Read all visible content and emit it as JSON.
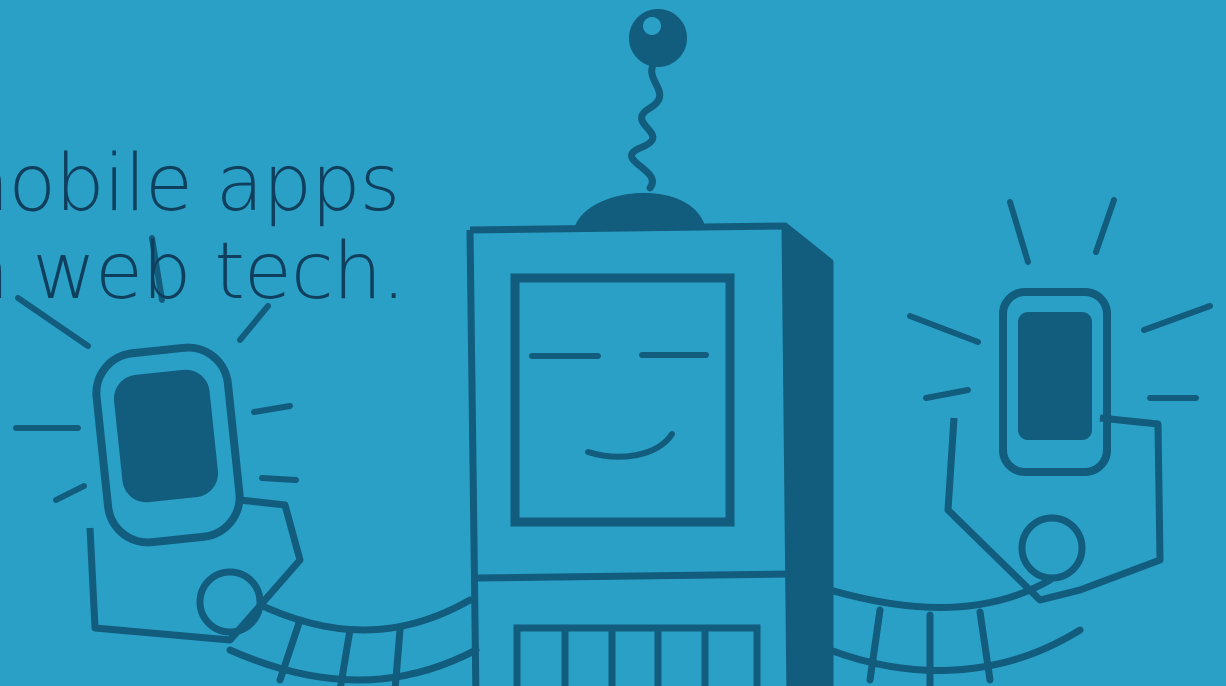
{
  "hero": {
    "headline_line1": "nobile apps",
    "headline_line2": "n web tech."
  },
  "colors": {
    "background": "#2aa0c6",
    "ink": "#125c7d",
    "text": "#0f3f5c"
  },
  "illustration": {
    "subject": "robot-holding-phones",
    "icons": [
      "robot-icon",
      "phone-icon",
      "phone-icon"
    ]
  }
}
